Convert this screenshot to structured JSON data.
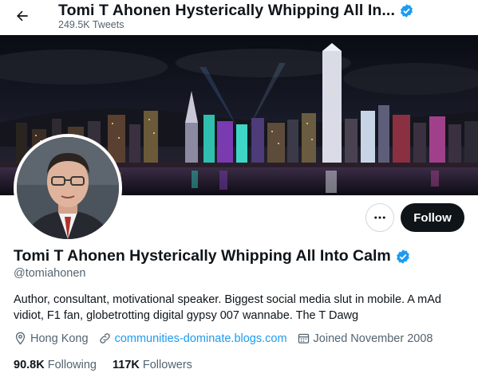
{
  "header": {
    "title": "Tomi T Ahonen Hysterically Whipping All In...",
    "tweet_count": "249.5K Tweets",
    "back_icon": "arrow-left-icon",
    "verified_icon": "verified-badge-icon"
  },
  "banner": {
    "description_icon": "city-skyline-night"
  },
  "actions": {
    "more_icon": "more-horizontal-icon",
    "follow_label": "Follow"
  },
  "profile": {
    "display_name": "Tomi T Ahonen Hysterically Whipping All Into Calm",
    "handle": "@tomiahonen",
    "bio": "Author, consultant, motivational speaker. Biggest social media slut in mobile. A mAd vidiot, F1 fan, globetrotting digital gypsy 007 wannabe. The T Dawg",
    "location": "Hong Kong",
    "website": "communities-dominate.blogs.com",
    "joined": "Joined November 2008"
  },
  "stats": {
    "following_count": "90.8K",
    "following_label": "Following",
    "followers_count": "117K",
    "followers_label": "Followers"
  },
  "colors": {
    "accent": "#1d9bf0",
    "text": "#0f1419",
    "secondary": "#536471",
    "follow_bg": "#0f1419"
  }
}
